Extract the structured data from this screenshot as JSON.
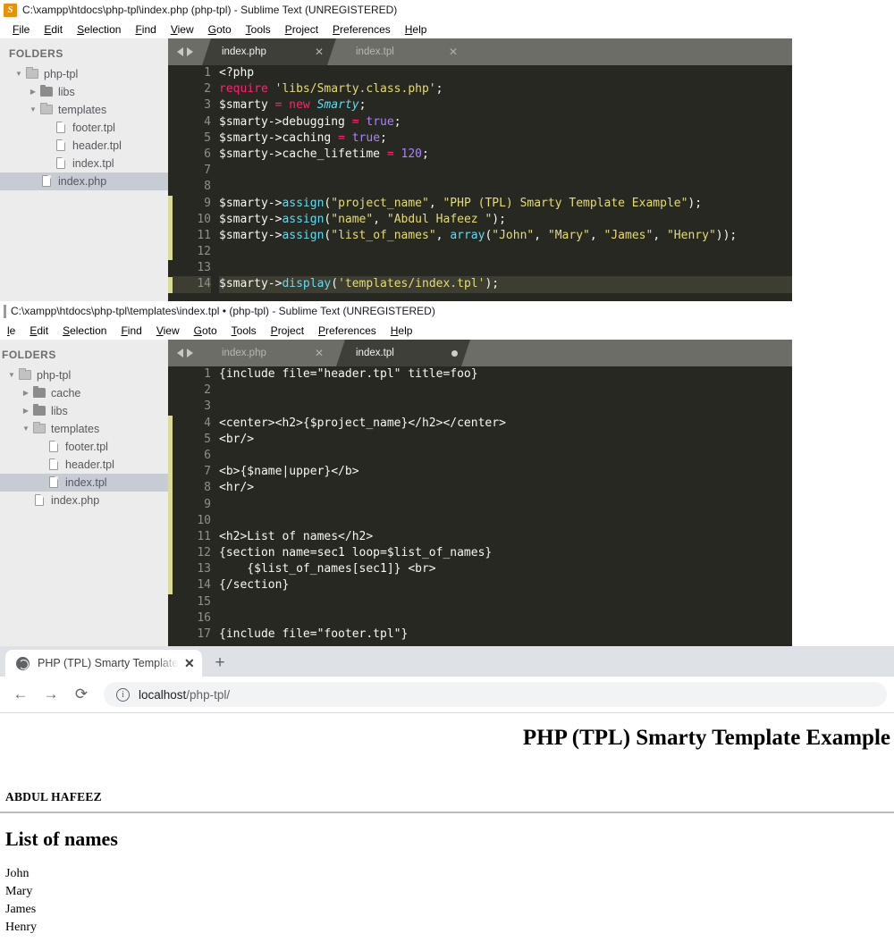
{
  "window1": {
    "title": "C:\\xampp\\htdocs\\php-tpl\\index.php (php-tpl) - Sublime Text (UNREGISTERED)",
    "logo_glyph": "S",
    "menu": [
      "File",
      "Edit",
      "Selection",
      "Find",
      "View",
      "Goto",
      "Tools",
      "Project",
      "Preferences",
      "Help"
    ],
    "sidebar": {
      "header": "FOLDERS",
      "items": [
        {
          "label": "php-tpl",
          "type": "folder-open",
          "depth": 0,
          "arrow": "▼",
          "selected": false
        },
        {
          "label": "libs",
          "type": "folder-closed",
          "depth": 1,
          "arrow": "▶",
          "selected": false
        },
        {
          "label": "templates",
          "type": "folder-open",
          "depth": 1,
          "arrow": "▼",
          "selected": false
        },
        {
          "label": "footer.tpl",
          "type": "file",
          "depth": 2,
          "arrow": "",
          "selected": false
        },
        {
          "label": "header.tpl",
          "type": "file",
          "depth": 2,
          "arrow": "",
          "selected": false
        },
        {
          "label": "index.tpl",
          "type": "file",
          "depth": 2,
          "arrow": "",
          "selected": false
        },
        {
          "label": "index.php",
          "type": "file",
          "depth": 1,
          "arrow": "",
          "selected": true
        }
      ]
    },
    "tabs": [
      {
        "label": "index.php",
        "active": true,
        "close": "✕",
        "modified": false
      },
      {
        "label": "index.tpl",
        "active": false,
        "close": "✕",
        "modified": false
      }
    ],
    "code": {
      "active_line": 14,
      "marker_ranges": [
        [
          9,
          12
        ],
        [
          14,
          14
        ]
      ],
      "lines": [
        {
          "n": 1,
          "tokens": [
            {
              "t": "<?php",
              "c": "c-plain"
            }
          ]
        },
        {
          "n": 2,
          "tokens": [
            {
              "t": "require",
              "c": "c-kw"
            },
            {
              "t": " ",
              "c": "c-plain"
            },
            {
              "t": "'libs/Smarty.class.php'",
              "c": "c-str"
            },
            {
              "t": ";",
              "c": "c-plain"
            }
          ]
        },
        {
          "n": 3,
          "tokens": [
            {
              "t": "$smarty",
              "c": "c-plain"
            },
            {
              "t": " ",
              "c": "c-plain"
            },
            {
              "t": "=",
              "c": "c-kw"
            },
            {
              "t": " ",
              "c": "c-plain"
            },
            {
              "t": "new",
              "c": "c-kw"
            },
            {
              "t": " ",
              "c": "c-plain"
            },
            {
              "t": "Smarty",
              "c": "c-cls"
            },
            {
              "t": ";",
              "c": "c-plain"
            }
          ]
        },
        {
          "n": 4,
          "tokens": [
            {
              "t": "$smarty->debugging",
              "c": "c-plain"
            },
            {
              "t": " ",
              "c": "c-plain"
            },
            {
              "t": "=",
              "c": "c-kw"
            },
            {
              "t": " ",
              "c": "c-plain"
            },
            {
              "t": "true",
              "c": "c-num"
            },
            {
              "t": ";",
              "c": "c-plain"
            }
          ]
        },
        {
          "n": 5,
          "tokens": [
            {
              "t": "$smarty->caching",
              "c": "c-plain"
            },
            {
              "t": " ",
              "c": "c-plain"
            },
            {
              "t": "=",
              "c": "c-kw"
            },
            {
              "t": " ",
              "c": "c-plain"
            },
            {
              "t": "true",
              "c": "c-num"
            },
            {
              "t": ";",
              "c": "c-plain"
            }
          ]
        },
        {
          "n": 6,
          "tokens": [
            {
              "t": "$smarty->cache_lifetime",
              "c": "c-plain"
            },
            {
              "t": " ",
              "c": "c-plain"
            },
            {
              "t": "=",
              "c": "c-kw"
            },
            {
              "t": " ",
              "c": "c-plain"
            },
            {
              "t": "120",
              "c": "c-num"
            },
            {
              "t": ";",
              "c": "c-plain"
            }
          ]
        },
        {
          "n": 7,
          "tokens": []
        },
        {
          "n": 8,
          "tokens": []
        },
        {
          "n": 9,
          "tokens": [
            {
              "t": "$smarty->",
              "c": "c-plain"
            },
            {
              "t": "assign",
              "c": "c-fn"
            },
            {
              "t": "(",
              "c": "c-plain"
            },
            {
              "t": "\"project_name\"",
              "c": "c-str"
            },
            {
              "t": ", ",
              "c": "c-plain"
            },
            {
              "t": "\"PHP (TPL) Smarty Template Example\"",
              "c": "c-str"
            },
            {
              "t": ");",
              "c": "c-plain"
            }
          ]
        },
        {
          "n": 10,
          "tokens": [
            {
              "t": "$smarty->",
              "c": "c-plain"
            },
            {
              "t": "assign",
              "c": "c-fn"
            },
            {
              "t": "(",
              "c": "c-plain"
            },
            {
              "t": "\"name\"",
              "c": "c-str"
            },
            {
              "t": ", ",
              "c": "c-plain"
            },
            {
              "t": "\"Abdul Hafeez \"",
              "c": "c-str"
            },
            {
              "t": ");",
              "c": "c-plain"
            }
          ]
        },
        {
          "n": 11,
          "tokens": [
            {
              "t": "$smarty->",
              "c": "c-plain"
            },
            {
              "t": "assign",
              "c": "c-fn"
            },
            {
              "t": "(",
              "c": "c-plain"
            },
            {
              "t": "\"list_of_names\"",
              "c": "c-str"
            },
            {
              "t": ", ",
              "c": "c-plain"
            },
            {
              "t": "array",
              "c": "c-fn"
            },
            {
              "t": "(",
              "c": "c-plain"
            },
            {
              "t": "\"John\"",
              "c": "c-str"
            },
            {
              "t": ", ",
              "c": "c-plain"
            },
            {
              "t": "\"Mary\"",
              "c": "c-str"
            },
            {
              "t": ", ",
              "c": "c-plain"
            },
            {
              "t": "\"James\"",
              "c": "c-str"
            },
            {
              "t": ", ",
              "c": "c-plain"
            },
            {
              "t": "\"Henry\"",
              "c": "c-str"
            },
            {
              "t": "));",
              "c": "c-plain"
            }
          ]
        },
        {
          "n": 12,
          "tokens": []
        },
        {
          "n": 13,
          "tokens": []
        },
        {
          "n": 14,
          "tokens": [
            {
              "t": "$smarty->",
              "c": "c-plain"
            },
            {
              "t": "display",
              "c": "c-fn"
            },
            {
              "t": "(",
              "c": "c-plain"
            },
            {
              "t": "'templates/index.tpl'",
              "c": "c-str"
            },
            {
              "t": ");",
              "c": "c-plain"
            }
          ]
        }
      ]
    }
  },
  "window2": {
    "title": "C:\\xampp\\htdocs\\php-tpl\\templates\\index.tpl • (php-tpl) - Sublime Text (UNREGISTERED)",
    "menu": [
      "le",
      "Edit",
      "Selection",
      "Find",
      "View",
      "Goto",
      "Tools",
      "Project",
      "Preferences",
      "Help"
    ],
    "sidebar": {
      "header": "FOLDERS",
      "items": [
        {
          "label": "php-tpl",
          "type": "folder-open",
          "depth": 0,
          "arrow": "▼",
          "selected": false
        },
        {
          "label": "cache",
          "type": "folder-closed",
          "depth": 1,
          "arrow": "▶",
          "selected": false
        },
        {
          "label": "libs",
          "type": "folder-closed",
          "depth": 1,
          "arrow": "▶",
          "selected": false
        },
        {
          "label": "templates",
          "type": "folder-open",
          "depth": 1,
          "arrow": "▼",
          "selected": false
        },
        {
          "label": "footer.tpl",
          "type": "file",
          "depth": 2,
          "arrow": "",
          "selected": false
        },
        {
          "label": "header.tpl",
          "type": "file",
          "depth": 2,
          "arrow": "",
          "selected": false
        },
        {
          "label": "index.tpl",
          "type": "file",
          "depth": 2,
          "arrow": "",
          "selected": true
        },
        {
          "label": "index.php",
          "type": "file",
          "depth": 1,
          "arrow": "",
          "selected": false
        }
      ]
    },
    "tabs": [
      {
        "label": "index.php",
        "active": false,
        "close": "✕",
        "modified": false
      },
      {
        "label": "index.tpl",
        "active": true,
        "close": "",
        "modified": true
      }
    ],
    "code": {
      "active_line": 0,
      "marker_ranges": [
        [
          4,
          14
        ]
      ],
      "lines": [
        {
          "n": 1,
          "tokens": [
            {
              "t": "{include file=\"header.tpl\" title=foo}",
              "c": "c-plain"
            }
          ]
        },
        {
          "n": 2,
          "tokens": []
        },
        {
          "n": 3,
          "tokens": []
        },
        {
          "n": 4,
          "tokens": [
            {
              "t": "<center><h2>{$project_name}</h2></center>",
              "c": "c-plain"
            }
          ]
        },
        {
          "n": 5,
          "tokens": [
            {
              "t": "<br/>",
              "c": "c-plain"
            }
          ]
        },
        {
          "n": 6,
          "tokens": []
        },
        {
          "n": 7,
          "tokens": [
            {
              "t": "<b>{$name|upper}</b>",
              "c": "c-plain"
            }
          ]
        },
        {
          "n": 8,
          "tokens": [
            {
              "t": "<hr/>",
              "c": "c-plain"
            }
          ]
        },
        {
          "n": 9,
          "tokens": []
        },
        {
          "n": 10,
          "tokens": []
        },
        {
          "n": 11,
          "tokens": [
            {
              "t": "<h2>List of names</h2>",
              "c": "c-plain"
            }
          ]
        },
        {
          "n": 12,
          "tokens": [
            {
              "t": "{section name=sec1 loop=$list_of_names}",
              "c": "c-plain"
            }
          ]
        },
        {
          "n": 13,
          "tokens": [
            {
              "t": "    {$list_of_names[sec1]} <br>",
              "c": "c-plain"
            }
          ]
        },
        {
          "n": 14,
          "tokens": [
            {
              "t": "{/section}",
              "c": "c-plain"
            }
          ]
        },
        {
          "n": 15,
          "tokens": []
        },
        {
          "n": 16,
          "tokens": []
        },
        {
          "n": 17,
          "tokens": [
            {
              "t": "{include file=\"footer.tpl\"}",
              "c": "c-plain"
            }
          ]
        }
      ]
    }
  },
  "browser": {
    "tab": {
      "title": "PHP (TPL) Smarty Template Exam",
      "close": "✕",
      "favicon": "globe-icon"
    },
    "newtab_label": "+",
    "nav": {
      "back": "←",
      "forward": "→",
      "reload": "⟳"
    },
    "omnibox": {
      "info": "i",
      "host": "localhost",
      "path": "/php-tpl/"
    },
    "page": {
      "project_title": "PHP (TPL) Smarty Template Example",
      "name_upper": "ABDUL HAFEEZ",
      "list_heading": "List of names",
      "names": [
        "John",
        "Mary",
        "James",
        "Henry"
      ]
    }
  },
  "colors": {
    "editor_bg": "#272822",
    "gutter_text": "#90908a",
    "tabbar_bg": "#6d6d68",
    "active_tab_bg": "#3f3f3a",
    "sidebar_bg": "#ececec",
    "selection_bg": "#c6cbd4",
    "marker": "#dcdc9a",
    "keyword": "#f92672",
    "string": "#e6db74",
    "number": "#ae81ff",
    "function": "#66d9ef",
    "chrome_tabstrip": "#dee1e6",
    "sublime_logo": "#e8920c"
  }
}
